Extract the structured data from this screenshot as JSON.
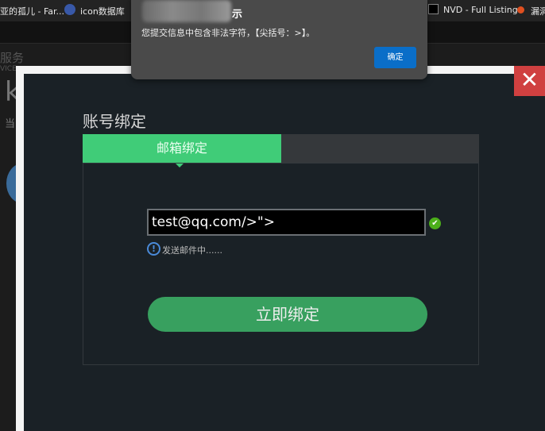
{
  "bookmarks": [
    {
      "label": "亚的孤儿 - Far..."
    },
    {
      "label": "icon数据库",
      "icon": "globe-icon"
    },
    {
      "label": "NVD - Full Listing",
      "icon": "nvd-icon"
    },
    {
      "label": "漏洞",
      "icon": "bug-icon"
    }
  ],
  "background": {
    "text1": "服务",
    "text2": "VICE",
    "k": "k",
    "dang": "当"
  },
  "modal": {
    "title": "账号绑定",
    "close": "✕",
    "tabs": [
      {
        "label": "邮箱绑定",
        "active": true
      }
    ],
    "email_value": "test@qq.com/>\">",
    "hint": "发送邮件中......",
    "bind_button": "立即绑定"
  },
  "alert": {
    "title": "提示",
    "title_visible": "示",
    "message": "您提交信息中包含非法字符，【尖括号：>】。",
    "ok": "确定"
  },
  "colors": {
    "accent": "#40cc78",
    "button": "#38a05f",
    "close": "#d04040",
    "ok": "#0a6ec8"
  }
}
